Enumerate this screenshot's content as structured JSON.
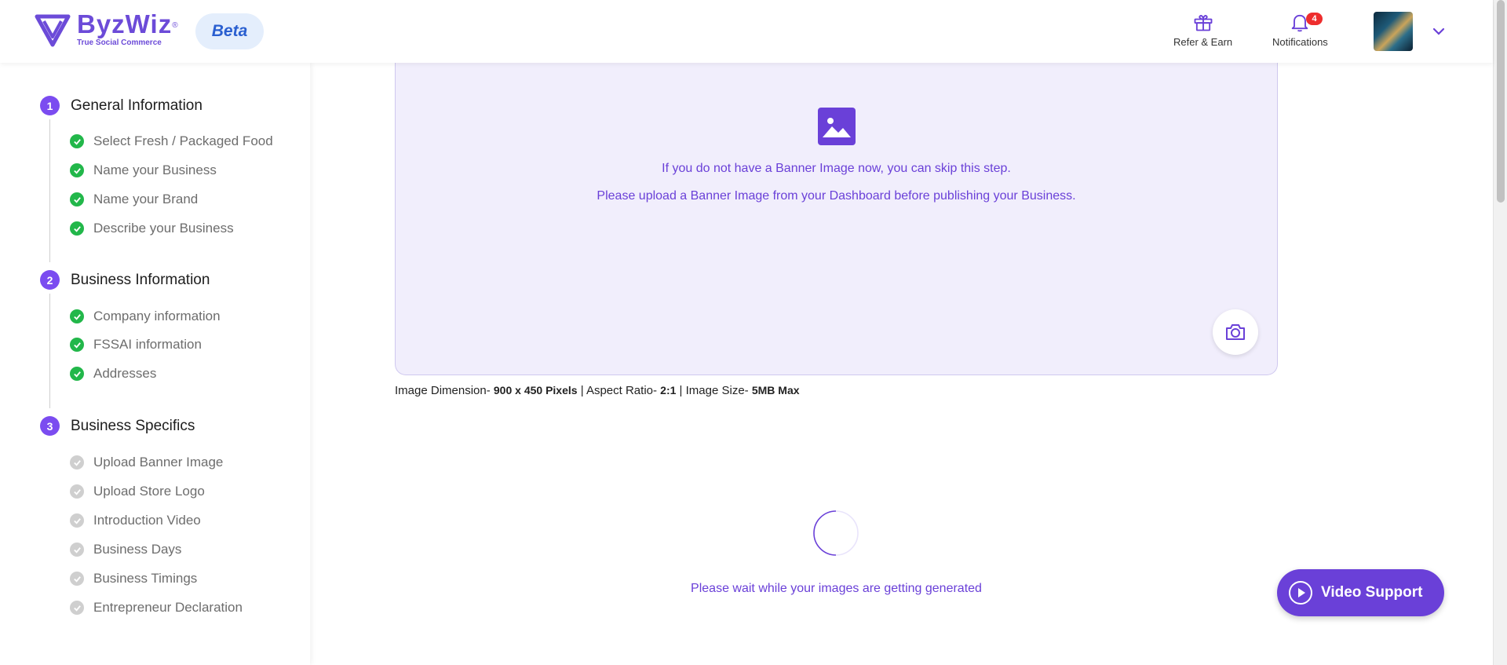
{
  "brand": {
    "name": "ByzWiz",
    "registered": "®",
    "tagline": "True Social Commerce",
    "beta_label": "Beta",
    "accent": "#6c4bd8"
  },
  "header": {
    "refer_label": "Refer & Earn",
    "notifications_label": "Notifications",
    "notifications_count": "4"
  },
  "sidebar": {
    "steps": [
      {
        "number": "1",
        "title": "General Information",
        "items": [
          {
            "label": "Select Fresh / Packaged Food",
            "status": "done"
          },
          {
            "label": "Name your Business",
            "status": "done"
          },
          {
            "label": "Name your Brand",
            "status": "done"
          },
          {
            "label": "Describe your Business",
            "status": "done"
          }
        ]
      },
      {
        "number": "2",
        "title": "Business Information",
        "items": [
          {
            "label": "Company information",
            "status": "done"
          },
          {
            "label": "FSSAI information",
            "status": "done"
          },
          {
            "label": "Addresses",
            "status": "done"
          }
        ]
      },
      {
        "number": "3",
        "title": "Business Specifics",
        "items": [
          {
            "label": "Upload Banner Image",
            "status": "pending"
          },
          {
            "label": "Upload Store Logo",
            "status": "pending"
          },
          {
            "label": "Introduction Video",
            "status": "pending"
          },
          {
            "label": "Business Days",
            "status": "pending"
          },
          {
            "label": "Business Timings",
            "status": "pending"
          },
          {
            "label": "Entrepreneur Declaration",
            "status": "pending"
          }
        ]
      }
    ]
  },
  "upload": {
    "line1": "If you do not have a Banner Image now, you can skip this step.",
    "line2": "Please upload a Banner Image from your Dashboard before publishing your Business."
  },
  "dimensions": {
    "dim_label": "Image Dimension- ",
    "dim_value": "900 x 450 Pixels",
    "ratio_label": " | Aspect Ratio- ",
    "ratio_value": "2:1",
    "size_label": " | Image Size- ",
    "size_value": "5MB Max"
  },
  "loading_text": "Please wait while your images are getting generated",
  "video_support_label": "Video Support"
}
